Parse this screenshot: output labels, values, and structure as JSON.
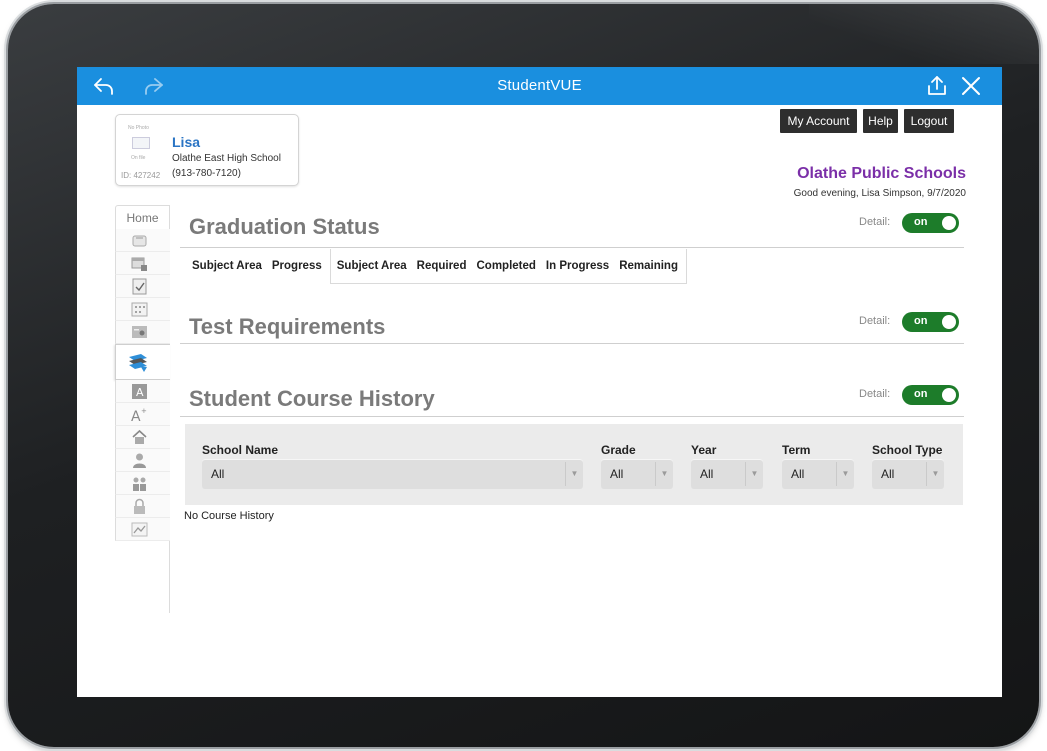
{
  "app": {
    "title": "StudentVUE"
  },
  "student": {
    "photo_text_top": "No Photo",
    "photo_text_bottom": "On file",
    "name": "Lisa",
    "school": "Olathe East High School",
    "phone": "(913-780-7120)",
    "id": "ID: 427242"
  },
  "header": {
    "buttons": [
      "My Account",
      "Help",
      "Logout"
    ],
    "district": "Olathe Public Schools",
    "greeting": "Good evening, Lisa Simpson, 9/7/2020"
  },
  "nav": {
    "home": "Home",
    "icons": [
      "mailbox-icon",
      "calendar-lock-icon",
      "attendance-check-icon",
      "schedule-grid-icon",
      "class-roster-icon",
      "course-history-books-icon",
      "report-card-icon",
      "grade-book-icon",
      "school-info-icon",
      "student-info-icon",
      "family-icon",
      "lock-icon",
      "progress-chart-icon"
    ],
    "active": "course-history-books-icon"
  },
  "detail_label": "Detail:",
  "toggle_label": "on",
  "graduation": {
    "title": "Graduation Status",
    "columns_left": [
      "Subject Area",
      "Progress"
    ],
    "columns_right": [
      "Subject Area",
      "Required",
      "Completed",
      "In Progress",
      "Remaining"
    ]
  },
  "tests": {
    "title": "Test Requirements"
  },
  "history": {
    "title": "Student Course History",
    "filters": [
      {
        "label": "School Name",
        "value": "All"
      },
      {
        "label": "Grade",
        "value": "All"
      },
      {
        "label": "Year",
        "value": "All"
      },
      {
        "label": "Term",
        "value": "All"
      },
      {
        "label": "School Type",
        "value": "All"
      }
    ],
    "empty_message": "No Course History"
  },
  "colors": {
    "titlebar": "#1a8fdf",
    "district": "#7b2fa8",
    "name": "#2a74c4",
    "toggle": "#1d7c2a"
  }
}
